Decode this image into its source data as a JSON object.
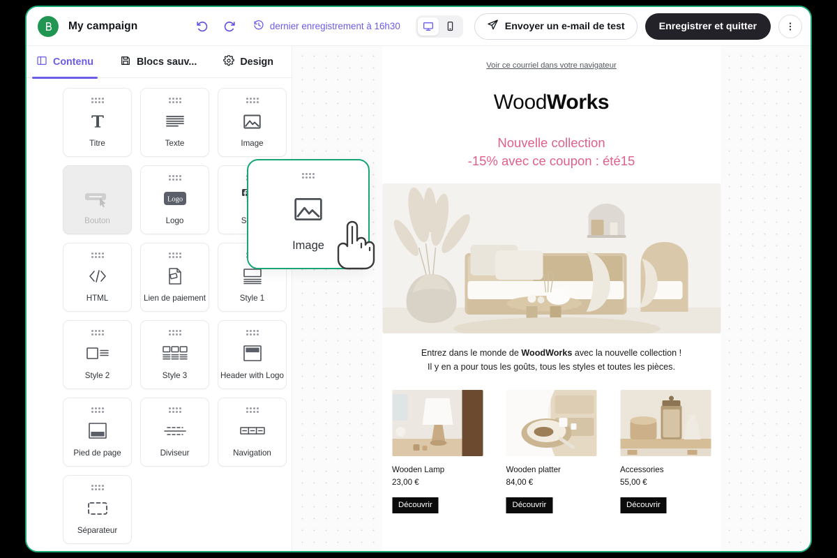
{
  "window": {
    "accent_border": "#19a974"
  },
  "topbar": {
    "logo_icon": "brevo-b-logo-icon",
    "campaign_title": "My campaign",
    "undo_icon": "undo-arrow-icon",
    "redo_icon": "redo-arrow-icon",
    "save_status_icon": "history-clock-icon",
    "save_status": "dernier enregistrement à 16h30",
    "device_desktop_icon": "desktop-monitor-icon",
    "device_mobile_icon": "mobile-phone-icon",
    "device_selected": "desktop",
    "send_test_icon": "paper-plane-icon",
    "send_test_label": "Envoyer un e-mail de test",
    "save_quit_label": "Enregistrer et quitter",
    "more_icon": "kebab-menu-icon",
    "accent_purple": "#6b5ce8",
    "dark_button_bg": "#222228"
  },
  "panel": {
    "tabs": [
      {
        "label": "Contenu",
        "icon": "layout-columns-icon",
        "active": true
      },
      {
        "label": "Blocs sauv...",
        "icon": "floppy-disk-icon",
        "active": false
      },
      {
        "label": "Design",
        "icon": "gear-icon",
        "active": false
      }
    ],
    "blocks": [
      {
        "label": "Titre",
        "icon": "title-serif-t-icon",
        "disabled": false
      },
      {
        "label": "Texte",
        "icon": "text-lines-icon",
        "disabled": false
      },
      {
        "label": "Image",
        "icon": "image-mountain-icon",
        "disabled": false
      },
      {
        "label": "Bouton",
        "icon": "button-cursor-icon",
        "disabled": true
      },
      {
        "label": "Logo",
        "icon": "logo-badge-icon",
        "disabled": false
      },
      {
        "label": "Social",
        "icon": "social-networks-icon",
        "disabled": false
      },
      {
        "label": "HTML",
        "icon": "code-brackets-icon",
        "disabled": false
      },
      {
        "label": "Lien de paiement",
        "icon": "payment-document-icon",
        "disabled": false
      },
      {
        "label": "Style 1",
        "icon": "style-one-layout-icon",
        "disabled": false
      },
      {
        "label": "Style 2",
        "icon": "style-two-layout-icon",
        "disabled": false
      },
      {
        "label": "Style 3",
        "icon": "style-three-layout-icon",
        "disabled": false
      },
      {
        "label": "Header with Logo",
        "icon": "header-logo-layout-icon",
        "disabled": false
      },
      {
        "label": "Pied de page",
        "icon": "footer-layout-icon",
        "disabled": false
      },
      {
        "label": "Diviseur",
        "icon": "divider-lines-icon",
        "disabled": false
      },
      {
        "label": "Navigation",
        "icon": "navigation-bar-icon",
        "disabled": false
      },
      {
        "label": "Séparateur",
        "icon": "spacer-dashed-icon",
        "disabled": false
      }
    ]
  },
  "drag": {
    "ghost_label": "Image",
    "ghost_icon": "image-mountain-icon",
    "cursor_icon": "pointing-hand-cursor-icon",
    "highlight_color": "#17a673"
  },
  "email": {
    "preheader": "Voir ce courriel dans votre navigateur",
    "logo_light": "Wood",
    "logo_bold": "Works",
    "promo_line1": "Nouvelle collection",
    "promo_line2": "-15% avec ce coupon : été15",
    "promo_color": "#e0608a",
    "hero_alt": "living-room-rattan-sofa-hero-image",
    "body_line1_pre": "Entrez dans le monde de ",
    "body_line1_bold": "WoodWorks",
    "body_line1_post": " avec la nouvelle collection !",
    "body_line2": "Il y en a pour tous les goûts, tous les styles et toutes les pièces.",
    "products": [
      {
        "name": "Wooden Lamp",
        "price": "23,00 €",
        "cta": "Découvrir",
        "image_alt": "wooden-lamp-photo"
      },
      {
        "name": "Wooden platter",
        "price": "84,00 €",
        "cta": "Découvrir",
        "image_alt": "wooden-platter-photo"
      },
      {
        "name": "Accessories",
        "price": "55,00 €",
        "cta": "Découvrir",
        "image_alt": "accessories-jars-photo"
      }
    ]
  }
}
